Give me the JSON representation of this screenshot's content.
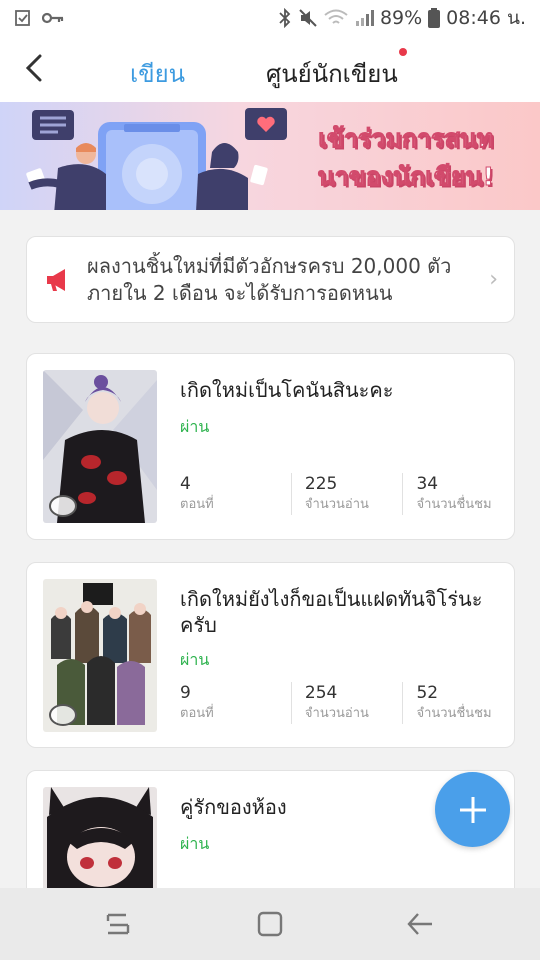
{
  "status_bar": {
    "battery": "89%",
    "time": "08:46 น."
  },
  "header": {
    "tabs": [
      {
        "label": "เขียน",
        "active": true
      },
      {
        "label": "ศูนย์นักเขียน",
        "active": false,
        "has_notification_dot": true
      }
    ]
  },
  "banner": {
    "line1": "เข้าร่วมการสนท",
    "line2": "นาของนักเขียน!"
  },
  "notice": {
    "text": "ผลงานชิ้นใหม่ที่มีตัวอักษรครบ 20,000 ตัวภายใน 2 เดือน จะได้รับการอดหนน"
  },
  "works": [
    {
      "title": "เกิดใหม่เป็นโคนันสินะคะ",
      "status": "ผ่าน",
      "stats": [
        {
          "value": "4",
          "label": "ตอนที่"
        },
        {
          "value": "225",
          "label": "จำนวนอ่าน"
        },
        {
          "value": "34",
          "label": "จำนวนชื่นชม"
        }
      ]
    },
    {
      "title": "เกิดใหม่ยังไงก็ขอเป็นแฝดทันจิโร่นะครับ",
      "status": "ผ่าน",
      "stats": [
        {
          "value": "9",
          "label": "ตอนที่"
        },
        {
          "value": "254",
          "label": "จำนวนอ่าน"
        },
        {
          "value": "52",
          "label": "จำนวนชื่นชม"
        }
      ]
    },
    {
      "title": "คู่รักของห้อง",
      "status": "ผ่าน"
    }
  ],
  "colors": {
    "accent": "#3d9be0",
    "pass_green": "#2fb34f",
    "fab": "#4a9fea",
    "notification_dot": "#e8394a"
  }
}
